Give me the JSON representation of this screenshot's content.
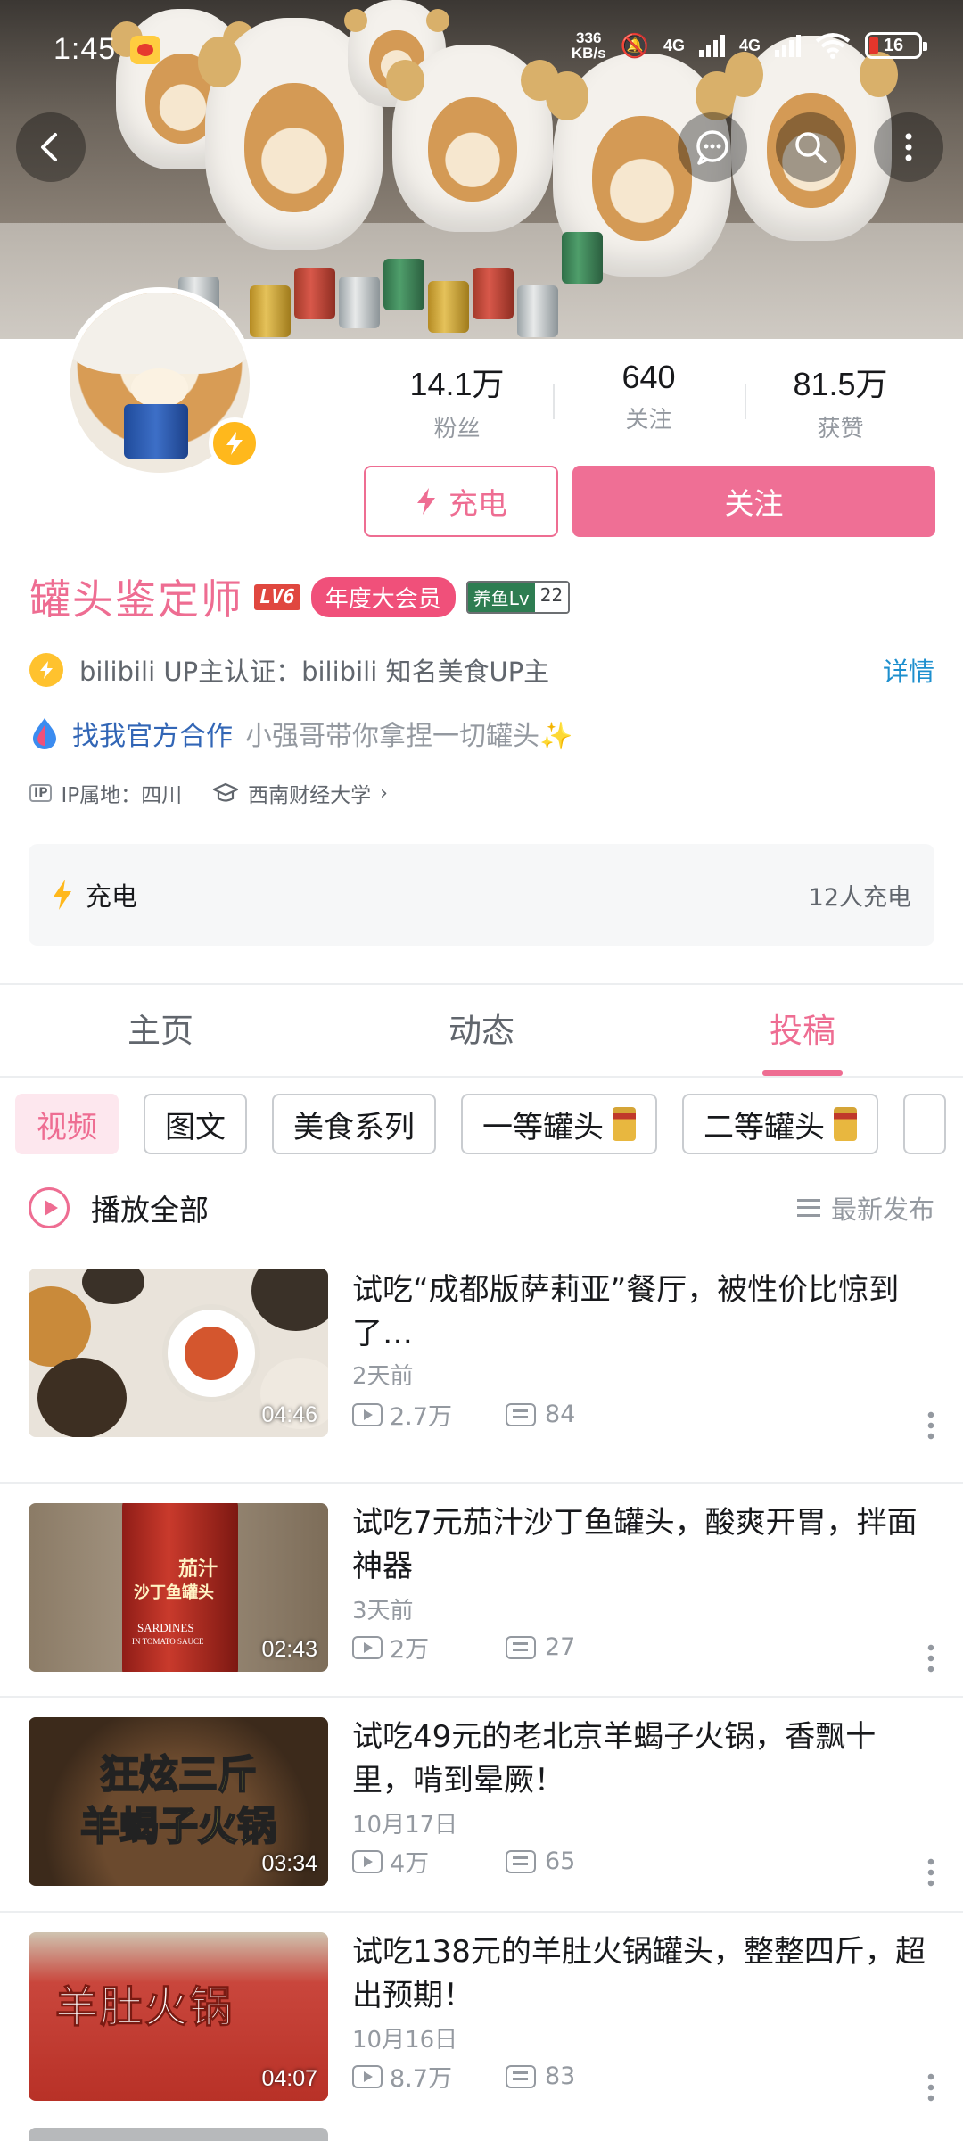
{
  "status_bar": {
    "time": "1:45",
    "net_speed_value": "336",
    "net_speed_unit": "KB/s",
    "net1": "4G",
    "net2": "4G",
    "battery": "16"
  },
  "profile": {
    "name": "罐头鉴定师",
    "level_badge": "LV6",
    "vip_badge": "年度大会员",
    "fish_badge_label": "养鱼Lv",
    "fish_badge_level": "22",
    "stats": [
      {
        "value": "14.1万",
        "label": "粉丝"
      },
      {
        "value": "640",
        "label": "关注"
      },
      {
        "value": "81.5万",
        "label": "获赞"
      }
    ],
    "charge_button": "充电",
    "follow_button": "关注",
    "verify_text": "bilibili UP主认证：bilibili 知名美食UP主",
    "verify_more": "详情",
    "coop_link": "找我官方合作",
    "bio": "小强哥带你拿捏一切罐头✨",
    "ip_tag": "IP",
    "ip_text": "IP属地：四川",
    "school": "西南财经大学",
    "charge_card_title": "充电",
    "charge_card_count": "12人充电"
  },
  "tabs": [
    {
      "label": "主页",
      "active": false
    },
    {
      "label": "动态",
      "active": false
    },
    {
      "label": "投稿",
      "active": true
    }
  ],
  "chips": [
    "视频",
    "图文",
    "美食系列",
    "一等罐头",
    "二等罐头"
  ],
  "play_all": {
    "label": "播放全部",
    "sort": "最新发布"
  },
  "videos": [
    {
      "title": "试吃“成都版萨莉亚”餐厅，被性价比惊到了…",
      "date": "2天前",
      "plays": "2.7万",
      "danmaku": "84",
      "duration": "04:46"
    },
    {
      "title": "试吃7元茄汁沙丁鱼罐头，酸爽开胃，拌面神器",
      "date": "3天前",
      "plays": "2万",
      "danmaku": "27",
      "duration": "02:43"
    },
    {
      "title": "试吃49元的老北京羊蝎子火锅，香飘十里，啃到晕厥！",
      "date": "10月17日",
      "plays": "4万",
      "danmaku": "65",
      "duration": "03:34"
    },
    {
      "title": "试吃138元的羊肚火锅罐头，整整四斤，超出预期！",
      "date": "10月16日",
      "plays": "8.7万",
      "danmaku": "83",
      "duration": "04:07"
    }
  ],
  "thumb_text": {
    "t2_label": "茄汁",
    "t2_sub": "沙丁鱼罐头",
    "t2_en1": "SARDINES",
    "t2_en2": "IN TOMATO SAUCE",
    "t3_line1": "狂炫三斤",
    "t3_line2": "羊蝎子火锅",
    "t4_text": "羊肚火锅"
  },
  "colors": {
    "accent": "#ee6d92",
    "link": "#3266b6",
    "info": "#1d8fce"
  }
}
